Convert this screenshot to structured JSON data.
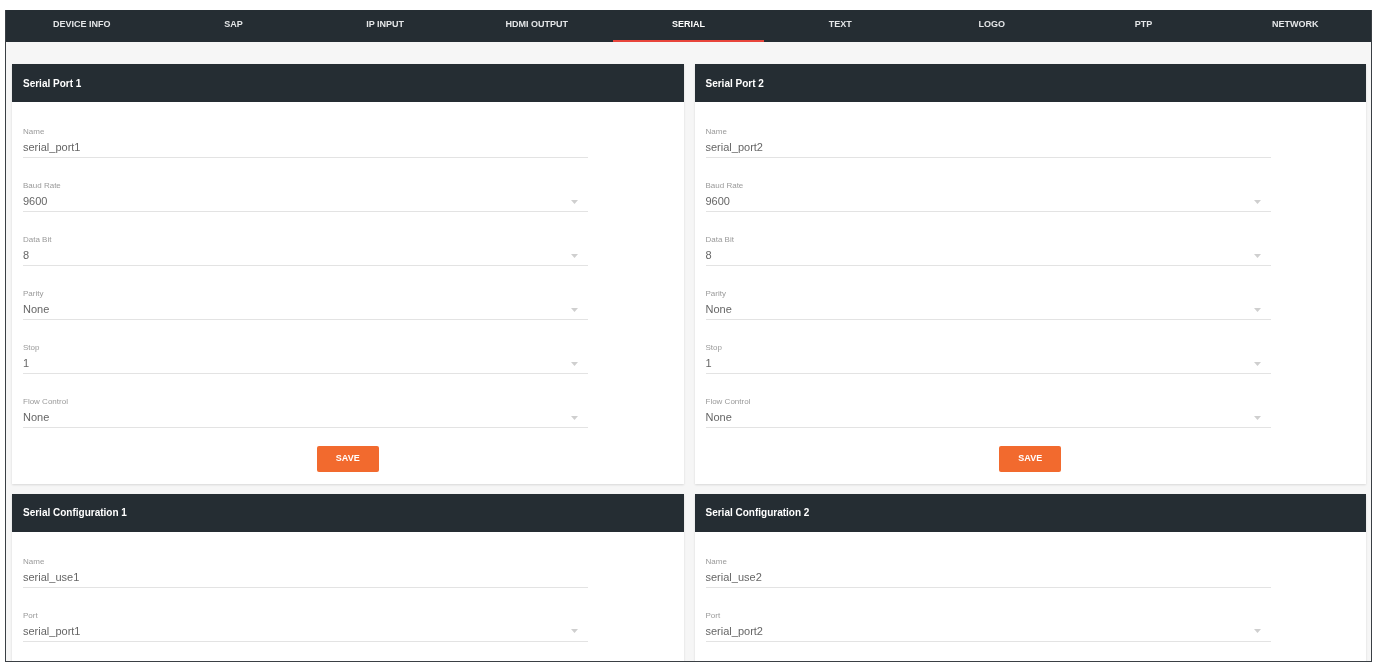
{
  "tabs": [
    {
      "label": "DEVICE INFO",
      "selected": false
    },
    {
      "label": "SAP",
      "selected": false
    },
    {
      "label": "IP INPUT",
      "selected": false
    },
    {
      "label": "HDMI OUTPUT",
      "selected": false
    },
    {
      "label": "SERIAL",
      "selected": true
    },
    {
      "label": "TEXT",
      "selected": false
    },
    {
      "label": "LOGO",
      "selected": false
    },
    {
      "label": "PTP",
      "selected": false
    },
    {
      "label": "NETWORK",
      "selected": false
    }
  ],
  "panels": [
    {
      "title": "Serial Port 1",
      "fields": [
        {
          "label": "Name",
          "value": "serial_port1",
          "kind": "text"
        },
        {
          "label": "Baud Rate",
          "value": "9600",
          "kind": "select"
        },
        {
          "label": "Data Bit",
          "value": "8",
          "kind": "select"
        },
        {
          "label": "Parity",
          "value": "None",
          "kind": "select"
        },
        {
          "label": "Stop",
          "value": "1",
          "kind": "select"
        },
        {
          "label": "Flow Control",
          "value": "None",
          "kind": "select"
        }
      ],
      "button": "SAVE"
    },
    {
      "title": "Serial Port 2",
      "fields": [
        {
          "label": "Name",
          "value": "serial_port2",
          "kind": "text"
        },
        {
          "label": "Baud Rate",
          "value": "9600",
          "kind": "select"
        },
        {
          "label": "Data Bit",
          "value": "8",
          "kind": "select"
        },
        {
          "label": "Parity",
          "value": "None",
          "kind": "select"
        },
        {
          "label": "Stop",
          "value": "1",
          "kind": "select"
        },
        {
          "label": "Flow Control",
          "value": "None",
          "kind": "select"
        }
      ],
      "button": "SAVE"
    },
    {
      "title": "Serial Configuration 1",
      "fields": [
        {
          "label": "Name",
          "value": "serial_use1",
          "kind": "text"
        },
        {
          "label": "Port",
          "value": "serial_port1",
          "kind": "select"
        }
      ]
    },
    {
      "title": "Serial Configuration 2",
      "fields": [
        {
          "label": "Name",
          "value": "serial_use2",
          "kind": "text"
        },
        {
          "label": "Port",
          "value": "serial_port2",
          "kind": "select"
        }
      ]
    }
  ]
}
